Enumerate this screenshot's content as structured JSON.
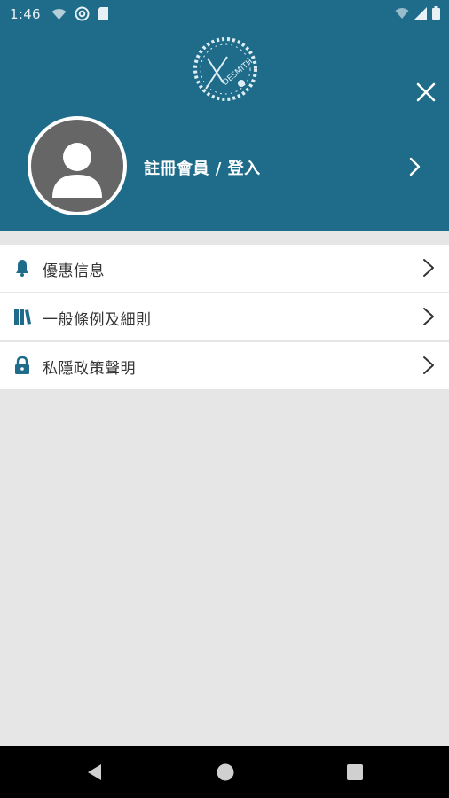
{
  "status_bar": {
    "time": "1:46",
    "left_icons": [
      "wifi-icon",
      "at-icon",
      "sim-icon"
    ],
    "right_icons": [
      "wifi-signal-icon",
      "cell-signal-icon",
      "battery-icon"
    ]
  },
  "header": {
    "logo_text": "DESMITH",
    "profile_label": "註冊會員 / 登入",
    "colors": {
      "background": "#1f6c8a",
      "avatar": "#666666"
    }
  },
  "menu": {
    "items": [
      {
        "label": "優惠信息",
        "icon": "bell-icon"
      },
      {
        "label": "一般條例及細則",
        "icon": "books-icon"
      },
      {
        "label": "私隱政策聲明",
        "icon": "lock-icon"
      }
    ],
    "accent": "#1f6c8a"
  },
  "nav": {
    "buttons": [
      "back-icon",
      "home-icon",
      "recents-icon"
    ]
  }
}
